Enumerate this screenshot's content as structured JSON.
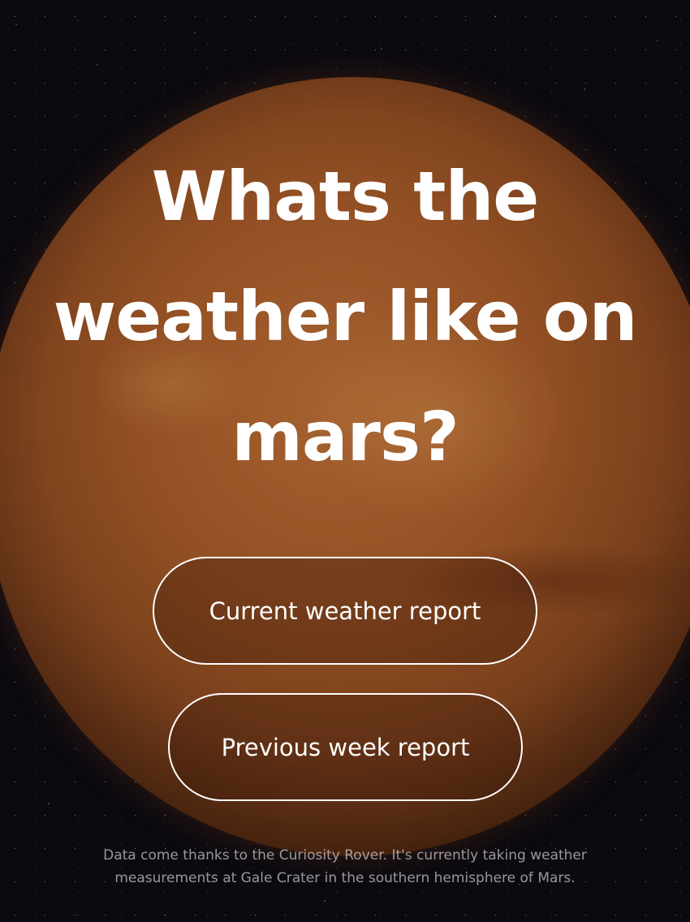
{
  "hero": {
    "title_line_1": "Whats the",
    "title_line_2": "weather like on",
    "title_line_3": "mars?"
  },
  "actions": {
    "current_label": "Current weather report",
    "previous_label": "Previous week report"
  },
  "footer": {
    "line_1": "Data come thanks to the Curiosity Rover. It's currently taking weather",
    "line_2": "measurements at Gale Crater in the southern hemisphere of Mars."
  }
}
